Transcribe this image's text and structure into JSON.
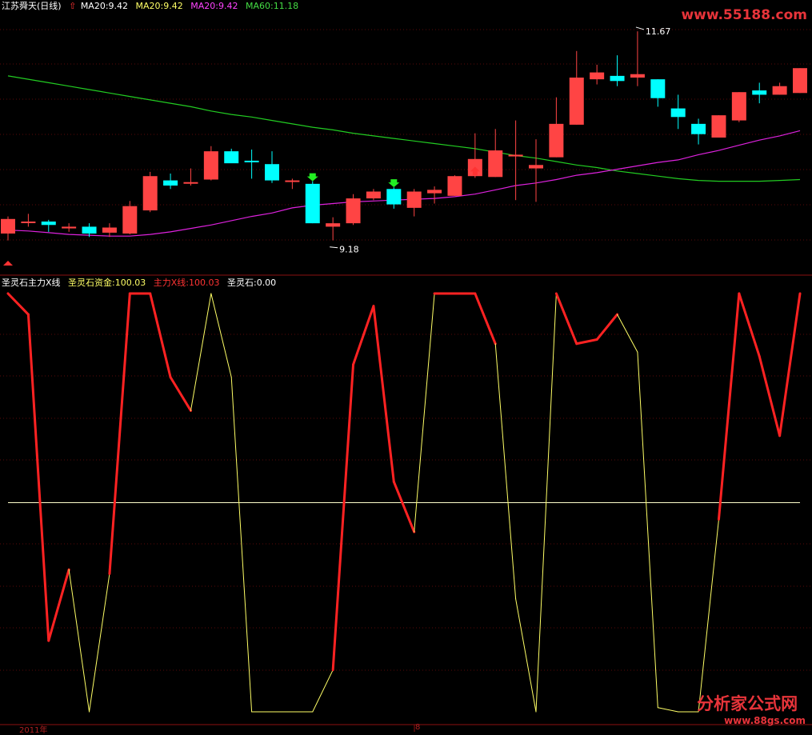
{
  "header_top": {
    "stock": "江苏舜天(日线)",
    "ma_items": [
      {
        "label": "MA20:9.42",
        "color": "#ffffff"
      },
      {
        "label": "MA20:9.42",
        "color": "#ffff66"
      },
      {
        "label": "MA20:9.42",
        "color": "#ff44ff"
      },
      {
        "label": "MA60:11.18",
        "color": "#44dd44"
      }
    ]
  },
  "header_bottom": {
    "items": [
      {
        "label": "圣灵石主力X线",
        "color": "#ffffff"
      },
      {
        "label": "圣灵石资金:100.03",
        "color": "#ffff66"
      },
      {
        "label": "主力X线:100.03",
        "color": "#ff3333"
      },
      {
        "label": "圣灵石:0.00",
        "color": "#ffffff"
      }
    ]
  },
  "watermark_top": "www.55188.com",
  "watermark_bottom": {
    "text": "分析家公式网",
    "url": "www.88gs.com"
  },
  "axis_labels": {
    "year": "2011年",
    "month": "8"
  },
  "colors": {
    "up": "#ff4444",
    "down": "#00ffff",
    "ma_short": "#dd22dd",
    "ma60": "#22cc22",
    "osc_red": "#ff2222",
    "osc_yellow": "#ffff66"
  },
  "chart_data": [
    {
      "type": "candlestick",
      "ylim": [
        9.0,
        11.8
      ],
      "annotations": [
        {
          "label": "11.67",
          "index": 31,
          "value": 11.67
        },
        {
          "label": "9.18",
          "index": 16,
          "value": 9.18
        }
      ],
      "candles": [
        {
          "o": 9.28,
          "h": 9.48,
          "l": 9.2,
          "c": 9.45
        },
        {
          "o": 9.42,
          "h": 9.51,
          "l": 9.36,
          "c": 9.42
        },
        {
          "o": 9.42,
          "h": 9.44,
          "l": 9.3,
          "c": 9.38
        },
        {
          "o": 9.34,
          "h": 9.4,
          "l": 9.3,
          "c": 9.36
        },
        {
          "o": 9.36,
          "h": 9.4,
          "l": 9.24,
          "c": 9.28
        },
        {
          "o": 9.29,
          "h": 9.4,
          "l": 9.24,
          "c": 9.35
        },
        {
          "o": 9.28,
          "h": 9.66,
          "l": 9.27,
          "c": 9.6
        },
        {
          "o": 9.55,
          "h": 10.0,
          "l": 9.53,
          "c": 9.95
        },
        {
          "o": 9.9,
          "h": 9.98,
          "l": 9.8,
          "c": 9.84
        },
        {
          "o": 9.87,
          "h": 10.04,
          "l": 9.84,
          "c": 9.88
        },
        {
          "o": 9.91,
          "h": 10.3,
          "l": 9.9,
          "c": 10.24
        },
        {
          "o": 10.24,
          "h": 10.27,
          "l": 10.12,
          "c": 10.1
        },
        {
          "o": 10.13,
          "h": 10.26,
          "l": 9.92,
          "c": 10.12
        },
        {
          "o": 10.09,
          "h": 10.24,
          "l": 9.87,
          "c": 9.9
        },
        {
          "o": 9.9,
          "h": 9.92,
          "l": 9.8,
          "c": 9.9
        },
        {
          "o": 9.86,
          "h": 9.89,
          "l": 9.4,
          "c": 9.4
        },
        {
          "o": 9.36,
          "h": 9.47,
          "l": 9.2,
          "c": 9.4
        },
        {
          "o": 9.4,
          "h": 9.74,
          "l": 9.38,
          "c": 9.69
        },
        {
          "o": 9.69,
          "h": 9.8,
          "l": 9.67,
          "c": 9.77
        },
        {
          "o": 9.8,
          "h": 9.82,
          "l": 9.57,
          "c": 9.62
        },
        {
          "o": 9.58,
          "h": 9.8,
          "l": 9.48,
          "c": 9.77
        },
        {
          "o": 9.75,
          "h": 9.83,
          "l": 9.63,
          "c": 9.79
        },
        {
          "o": 9.72,
          "h": 9.96,
          "l": 9.72,
          "c": 9.95
        },
        {
          "o": 9.95,
          "h": 10.45,
          "l": 9.93,
          "c": 10.15
        },
        {
          "o": 9.94,
          "h": 10.5,
          "l": 9.94,
          "c": 10.25
        },
        {
          "o": 10.18,
          "h": 10.6,
          "l": 9.67,
          "c": 10.2
        },
        {
          "o": 10.04,
          "h": 10.38,
          "l": 9.65,
          "c": 10.08
        },
        {
          "o": 10.17,
          "h": 10.87,
          "l": 10.17,
          "c": 10.56
        },
        {
          "o": 10.55,
          "h": 11.41,
          "l": 10.55,
          "c": 11.1
        },
        {
          "o": 11.08,
          "h": 11.25,
          "l": 11.02,
          "c": 11.16
        },
        {
          "o": 11.12,
          "h": 11.36,
          "l": 11.0,
          "c": 11.06
        },
        {
          "o": 11.1,
          "h": 11.64,
          "l": 11.0,
          "c": 11.14
        },
        {
          "o": 11.08,
          "h": 11.08,
          "l": 10.76,
          "c": 10.86
        },
        {
          "o": 10.74,
          "h": 10.9,
          "l": 10.5,
          "c": 10.64
        },
        {
          "o": 10.56,
          "h": 10.62,
          "l": 10.32,
          "c": 10.44
        },
        {
          "o": 10.4,
          "h": 10.66,
          "l": 10.4,
          "c": 10.66
        },
        {
          "o": 10.6,
          "h": 10.93,
          "l": 10.58,
          "c": 10.93
        },
        {
          "o": 10.95,
          "h": 11.04,
          "l": 10.8,
          "c": 10.9
        },
        {
          "o": 10.9,
          "h": 11.04,
          "l": 10.9,
          "c": 11.0
        },
        {
          "o": 10.92,
          "h": 11.21,
          "l": 10.92,
          "c": 11.21
        }
      ],
      "ma_short": [
        9.32,
        9.31,
        9.29,
        9.27,
        9.26,
        9.25,
        9.25,
        9.27,
        9.3,
        9.34,
        9.38,
        9.43,
        9.48,
        9.52,
        9.58,
        9.61,
        9.63,
        9.65,
        9.66,
        9.67,
        9.68,
        9.69,
        9.71,
        9.74,
        9.79,
        9.84,
        9.87,
        9.91,
        9.96,
        9.99,
        10.03,
        10.07,
        10.11,
        10.14,
        10.2,
        10.25,
        10.31,
        10.37,
        10.42,
        10.48
      ],
      "ma60": [
        11.12,
        11.08,
        11.04,
        11.0,
        10.96,
        10.92,
        10.88,
        10.84,
        10.8,
        10.76,
        10.71,
        10.67,
        10.64,
        10.6,
        10.56,
        10.52,
        10.49,
        10.45,
        10.42,
        10.39,
        10.36,
        10.33,
        10.3,
        10.27,
        10.23,
        10.19,
        10.16,
        10.12,
        10.08,
        10.05,
        10.01,
        9.98,
        9.95,
        9.92,
        9.9,
        9.89,
        9.89,
        9.89,
        9.9,
        9.91
      ]
    },
    {
      "type": "line",
      "ylim": [
        0,
        100
      ],
      "reference_line": 50,
      "values": [
        100,
        95,
        17,
        34,
        0,
        33,
        100,
        100,
        80,
        72,
        100,
        80,
        0,
        0,
        0,
        0,
        10,
        83,
        97,
        55,
        43,
        100,
        100,
        100,
        88,
        27,
        0,
        100,
        88,
        89,
        95,
        86,
        1,
        0,
        0,
        46,
        100,
        85,
        66,
        100
      ],
      "strong": [
        true,
        true,
        true,
        false,
        false,
        true,
        true,
        true,
        true,
        false,
        false,
        false,
        false,
        false,
        false,
        false,
        true,
        true,
        true,
        true,
        false,
        true,
        true,
        true,
        false,
        false,
        false,
        true,
        true,
        true,
        false,
        false,
        false,
        false,
        false,
        true,
        true,
        true,
        true,
        true
      ]
    }
  ]
}
